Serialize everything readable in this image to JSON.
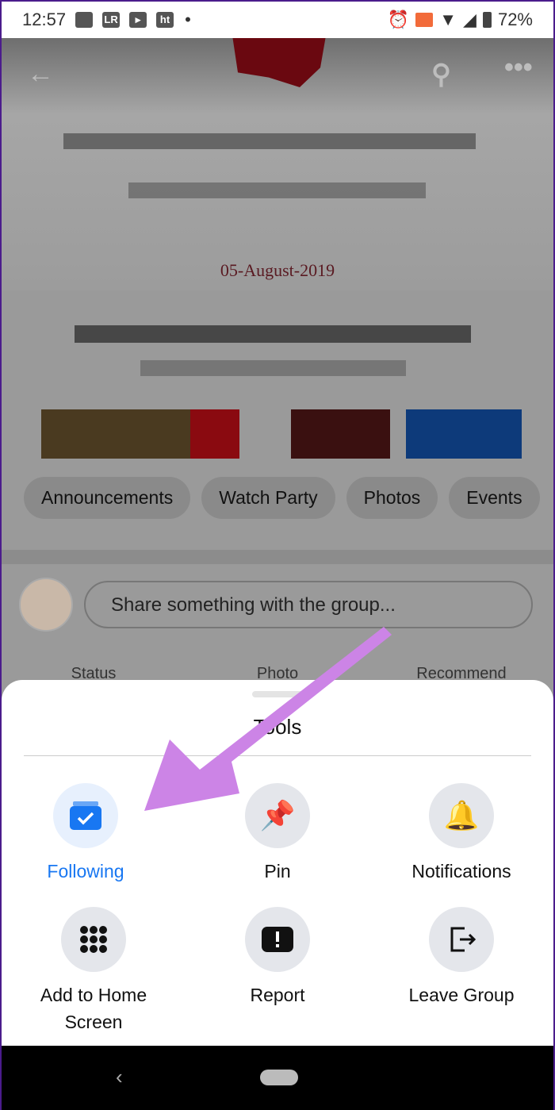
{
  "status_bar": {
    "time": "12:57",
    "battery": "72%",
    "icons": [
      "image-icon",
      "lightroom-icon",
      "youtube-icon",
      "ht-icon",
      "dot-icon",
      "alarm-icon",
      "cast-icon",
      "wifi-icon",
      "signal-icon",
      "battery-icon"
    ]
  },
  "cover": {
    "date": "05-August-2019"
  },
  "chips": [
    "Announcements",
    "Watch Party",
    "Photos",
    "Events"
  ],
  "composer": {
    "placeholder": "Share something with the group..."
  },
  "actions": [
    "Status",
    "Photo",
    "Recommend"
  ],
  "sheet": {
    "title": "Tools",
    "items": [
      {
        "label": "Following",
        "icon": "following-icon",
        "active": true
      },
      {
        "label": "Pin",
        "icon": "pin-icon"
      },
      {
        "label": "Notifications",
        "icon": "bell-icon"
      },
      {
        "label": "Add to Home Screen",
        "icon": "grid-icon"
      },
      {
        "label": "Report",
        "icon": "report-icon"
      },
      {
        "label": "Leave Group",
        "icon": "leave-icon"
      }
    ]
  },
  "colors": {
    "accent": "#1877f2",
    "annotation_arrow": "#cc84e6"
  }
}
